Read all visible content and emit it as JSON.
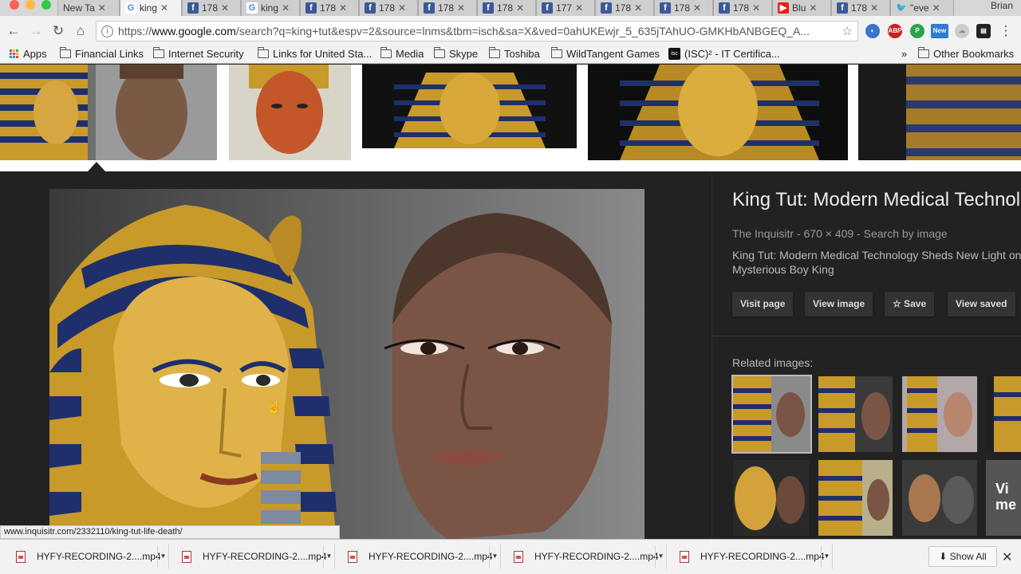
{
  "window": {
    "user_name": "Brian",
    "traffic_colors": [
      "#fc605b",
      "#fdbc40",
      "#34c84a"
    ]
  },
  "tabs": [
    {
      "label": "New Ta",
      "icon": "none",
      "active": false
    },
    {
      "label": "king",
      "icon": "google",
      "active": true
    },
    {
      "label": "178",
      "icon": "facebook",
      "active": false
    },
    {
      "label": "king",
      "icon": "google",
      "active": false
    },
    {
      "label": "178",
      "icon": "facebook",
      "active": false
    },
    {
      "label": "178",
      "icon": "facebook",
      "active": false
    },
    {
      "label": "178",
      "icon": "facebook",
      "active": false
    },
    {
      "label": "178",
      "icon": "facebook",
      "active": false
    },
    {
      "label": "177",
      "icon": "facebook",
      "active": false
    },
    {
      "label": "178",
      "icon": "facebook",
      "active": false
    },
    {
      "label": "178",
      "icon": "facebook",
      "active": false
    },
    {
      "label": "178",
      "icon": "facebook",
      "active": false
    },
    {
      "label": "Blu",
      "icon": "youtube",
      "active": false
    },
    {
      "label": "178",
      "icon": "facebook",
      "active": false
    },
    {
      "label": "\"eve",
      "icon": "twitter",
      "active": false
    }
  ],
  "toolbar": {
    "url_prefix": "https://",
    "url_host": "www.google.com",
    "url_rest": "/search?q=king+tut&espv=2&source=lnms&tbm=isch&sa=X&ved=0ahUKEwjr_5_635jTAhUO-GMKHbANBGEQ_A..."
  },
  "bookmarks": [
    {
      "label": "Apps",
      "icon": "apps-grid"
    },
    {
      "label": "Financial Links",
      "icon": "folder"
    },
    {
      "label": "Internet Security",
      "icon": "folder"
    },
    {
      "label": "Links for United Sta...",
      "icon": "folder"
    },
    {
      "label": "Media",
      "icon": "folder"
    },
    {
      "label": "Skype",
      "icon": "folder"
    },
    {
      "label": "Toshiba",
      "icon": "folder"
    },
    {
      "label": "WildTangent Games",
      "icon": "folder"
    },
    {
      "label": "(ISC)² - IT Certifica...",
      "icon": "isc-logo"
    }
  ],
  "bookmarks_overflow": "»",
  "other_bookmarks": "Other Bookmarks",
  "preview": {
    "title": "King Tut: Modern Medical Technology Sheds New Light on Mysterious Boy King",
    "source": "The Inquisitr",
    "dimensions": "670 × 409",
    "search_by_image": "Search by image",
    "separator": " - ",
    "description": "King Tut: Modern Medical Technology Sheds New Light on Mysterious Boy King",
    "buttons": {
      "visit": "Visit page",
      "view_image": "View image",
      "save": "Save",
      "view_saved": "View saved"
    },
    "related_label": "Related images:",
    "related_overlay": "Vi me"
  },
  "status_url": "www.inquisitr.com/2332110/king-tut-life-death/",
  "downloads": {
    "items": [
      "HYFY-RECORDING-2....mp4",
      "HYFY-RECORDING-2....mp4",
      "HYFY-RECORDING-2....mp4",
      "HYFY-RECORDING-2....mp4",
      "HYFY-RECORDING-2....mp4"
    ],
    "show_all": "Show All"
  },
  "colors": {
    "panel_bg": "#222222",
    "gold": "#c89a2a",
    "stripe_blue": "#1f2f6b"
  }
}
